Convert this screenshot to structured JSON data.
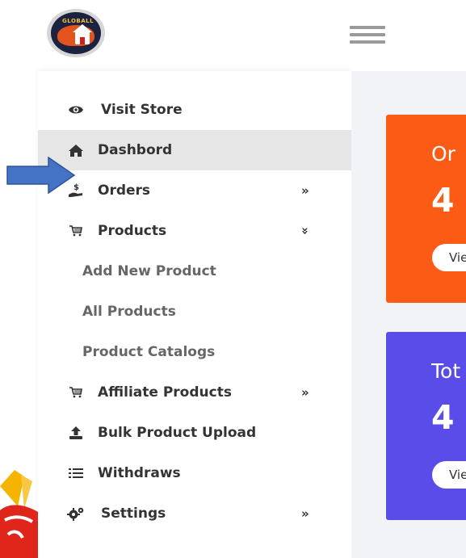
{
  "header": {
    "logo_text": "GLOBALL",
    "menu_icon": "hamburger-icon"
  },
  "sidebar": {
    "items": [
      {
        "label": "Visit Store",
        "icon": "eye-icon"
      },
      {
        "label": "Dashbord",
        "icon": "home-icon",
        "active": true
      },
      {
        "label": "Orders",
        "icon": "hand-dollar-icon",
        "chevron": "»"
      },
      {
        "label": "Products",
        "icon": "cart-icon",
        "chevron": "»",
        "expanded": true
      },
      {
        "label": "Affiliate Products",
        "icon": "cart-icon",
        "chevron": "»"
      },
      {
        "label": "Bulk Product Upload",
        "icon": "upload-icon"
      },
      {
        "label": "Withdraws",
        "icon": "list-icon"
      },
      {
        "label": "Settings",
        "icon": "gears-icon",
        "chevron": "»"
      }
    ],
    "product_subitems": [
      "Add New Product",
      "All Products",
      "Product Catalogs"
    ]
  },
  "cards": [
    {
      "title": "Or",
      "value": "4",
      "button": "Vie",
      "color": "#fc5b16"
    },
    {
      "title": "Tot",
      "value": "4",
      "button": "Vie",
      "color": "#5a4ce8"
    }
  ],
  "annotation": {
    "arrow_color": "#4472c4"
  }
}
